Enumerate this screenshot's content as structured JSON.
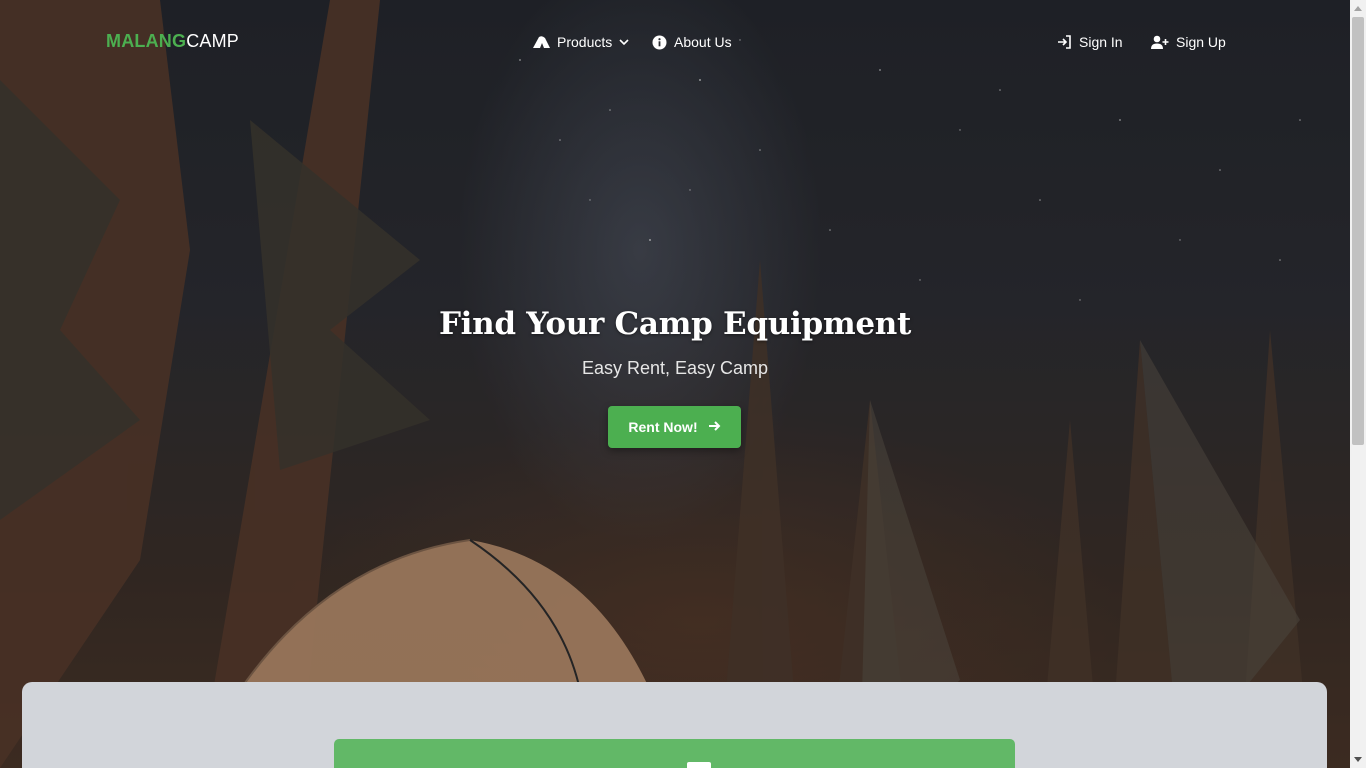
{
  "brand": {
    "part1": "MALANG",
    "part2": "CAMP"
  },
  "nav": {
    "products_label": "Products",
    "about_label": "About Us",
    "signin_label": "Sign In",
    "signup_label": "Sign Up"
  },
  "hero": {
    "title": "Find Your Camp Equipment",
    "subtitle": "Easy Rent, Easy Camp",
    "cta_label": "Rent Now!"
  },
  "colors": {
    "accent": "#4caf50",
    "panel": "#d2d5da",
    "card": "#62b867"
  },
  "icons": {
    "products": "tent-icon",
    "products_caret": "chevron-down-icon",
    "about": "info-circle-icon",
    "signin": "sign-in-icon",
    "signup": "user-plus-icon",
    "cta": "arrow-right-icon"
  }
}
